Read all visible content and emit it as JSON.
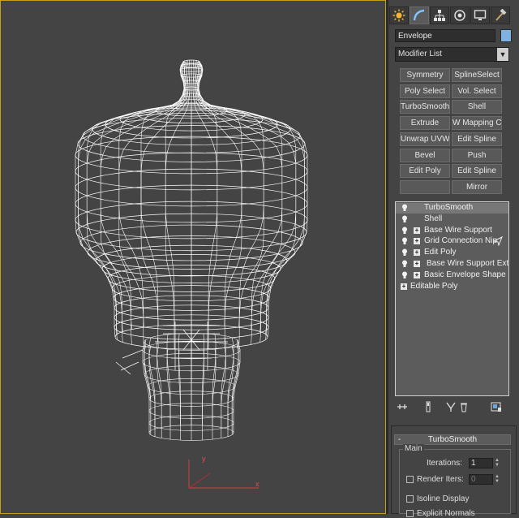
{
  "viewport": {
    "axis_labels": {
      "x": "x",
      "y": "y"
    }
  },
  "panel": {
    "tabs": [
      {
        "name": "create-tab",
        "icon": "sun-icon"
      },
      {
        "name": "modify-tab",
        "icon": "arc-icon"
      },
      {
        "name": "hierarchy-tab",
        "icon": "hierarchy-icon"
      },
      {
        "name": "motion-tab",
        "icon": "motion-icon"
      },
      {
        "name": "display-tab",
        "icon": "monitor-icon"
      },
      {
        "name": "utilities-tab",
        "icon": "hammer-icon"
      }
    ],
    "object_name": "Envelope",
    "object_color": "#7fb2e0",
    "modifier_list": "Modifier List",
    "modifier_buttons": [
      [
        "Symmetry",
        "SplineSelect"
      ],
      [
        "Poly Select",
        "Vol. Select"
      ],
      [
        "TurboSmooth",
        "Shell"
      ],
      [
        "Extrude",
        "W Mapping Cle"
      ],
      [
        "Unwrap UVW",
        "Edit Spline"
      ],
      [
        "Bevel",
        "Push"
      ],
      [
        "Edit Poly",
        "Edit Spline"
      ],
      [
        "",
        "Mirror"
      ]
    ],
    "stack": [
      {
        "label": "TurboSmooth",
        "bulb": true,
        "expand": false,
        "selected": true
      },
      {
        "label": "Shell",
        "bulb": true,
        "expand": false,
        "selected": false
      },
      {
        "label": "Base Wire Support",
        "bulb": true,
        "expand": true,
        "selected": false
      },
      {
        "label": "Grid Connection Nip",
        "bulb": true,
        "expand": true,
        "selected": false
      },
      {
        "label": "Edit Poly",
        "bulb": true,
        "expand": true,
        "selected": false
      },
      {
        "label": "Base Wire Support Extru",
        "bulb": true,
        "expand": true,
        "selected": false
      },
      {
        "label": "Basic Envelope Shape",
        "bulb": true,
        "expand": true,
        "selected": false
      },
      {
        "label": "Editable Poly",
        "bulb": false,
        "expand": true,
        "selected": false
      }
    ],
    "rollout": {
      "title": "TurboSmooth",
      "group": "Main",
      "iterations_label": "Iterations:",
      "iterations_value": "1",
      "render_iters_label": "Render Iters:",
      "render_iters_value": "0",
      "isoline_label": "Isoline Display",
      "explicit_normals_label": "Explicit Normals"
    }
  }
}
